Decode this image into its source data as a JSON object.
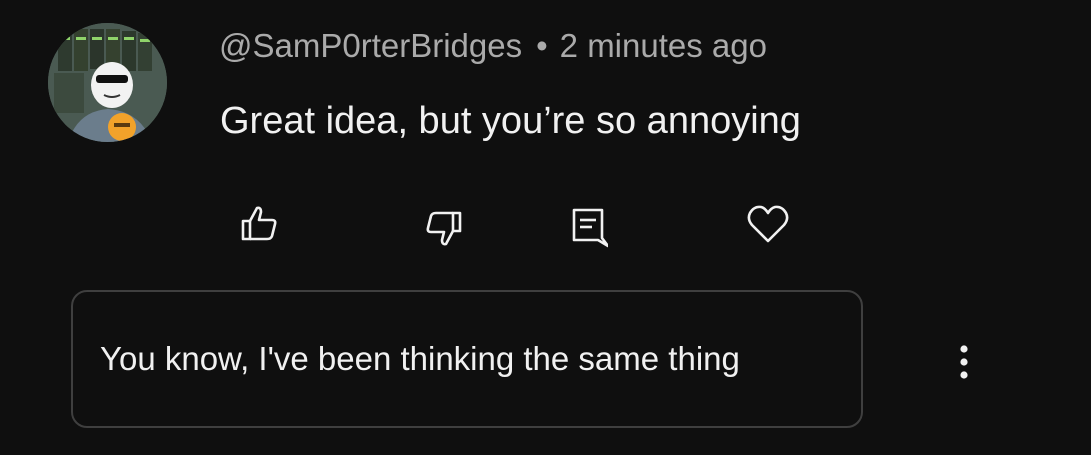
{
  "comment": {
    "author": "@SamP0rterBridges",
    "separator": "•",
    "time_ago": "2 minutes ago",
    "text": "Great idea, but you’re so annoying"
  },
  "actions": [
    {
      "name": "like",
      "icon": "thumbs-up-icon"
    },
    {
      "name": "dislike",
      "icon": "thumbs-down-icon"
    },
    {
      "name": "reply",
      "icon": "comment-icon"
    },
    {
      "name": "heart",
      "icon": "heart-icon"
    }
  ],
  "reply": {
    "text": "You know, I've been thinking the same thing"
  },
  "menu": {
    "icon": "more-vertical-icon"
  },
  "colors": {
    "background": "#0f0f0f",
    "text_primary": "#f1f1f1",
    "text_secondary": "#aaaaaa",
    "border": "#3f3f3f"
  }
}
